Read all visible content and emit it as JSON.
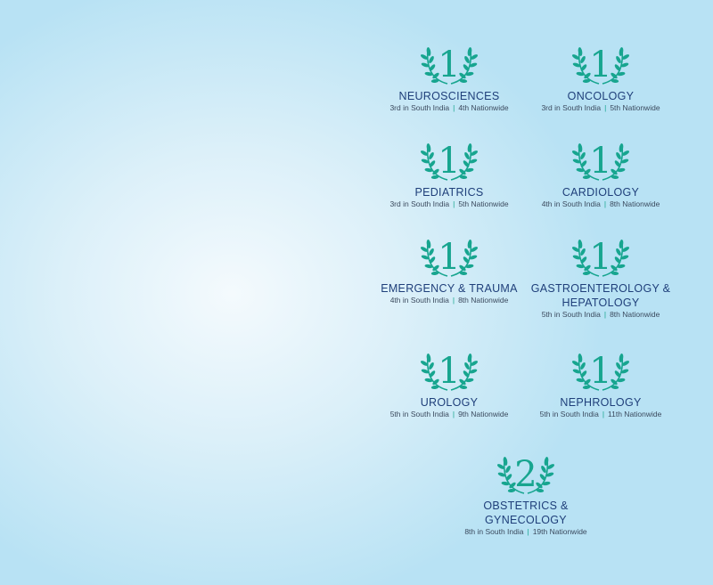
{
  "colors": {
    "accent": "#17a58f",
    "title": "#1f3f7a",
    "background": "#b8e2f4"
  },
  "awards": [
    {
      "rank": "1",
      "specialty": "NEUROSCIENCES",
      "south_india": "3rd in South India",
      "nationwide": "4th Nationwide"
    },
    {
      "rank": "1",
      "specialty": "ONCOLOGY",
      "south_india": "3rd in South India",
      "nationwide": "5th Nationwide"
    },
    {
      "rank": "1",
      "specialty": "PEDIATRICS",
      "south_india": "3rd in South India",
      "nationwide": "5th Nationwide"
    },
    {
      "rank": "1",
      "specialty": "CARDIOLOGY",
      "south_india": "4th in South India",
      "nationwide": "8th Nationwide"
    },
    {
      "rank": "1",
      "specialty": "EMERGENCY & TRAUMA",
      "south_india": "4th in South India",
      "nationwide": "8th Nationwide"
    },
    {
      "rank": "1",
      "specialty": "GASTROENTEROLOGY & HEPATOLOGY",
      "south_india": "5th in South India",
      "nationwide": "8th Nationwide"
    },
    {
      "rank": "1",
      "specialty": "UROLOGY",
      "south_india": "5th in South India",
      "nationwide": "9th Nationwide"
    },
    {
      "rank": "1",
      "specialty": "NEPHROLOGY",
      "south_india": "5th in South India",
      "nationwide": "11th Nationwide"
    },
    {
      "rank": "2",
      "specialty": "OBSTETRICS & GYNECOLOGY",
      "south_india": "8th in South India",
      "nationwide": "19th Nationwide"
    }
  ]
}
